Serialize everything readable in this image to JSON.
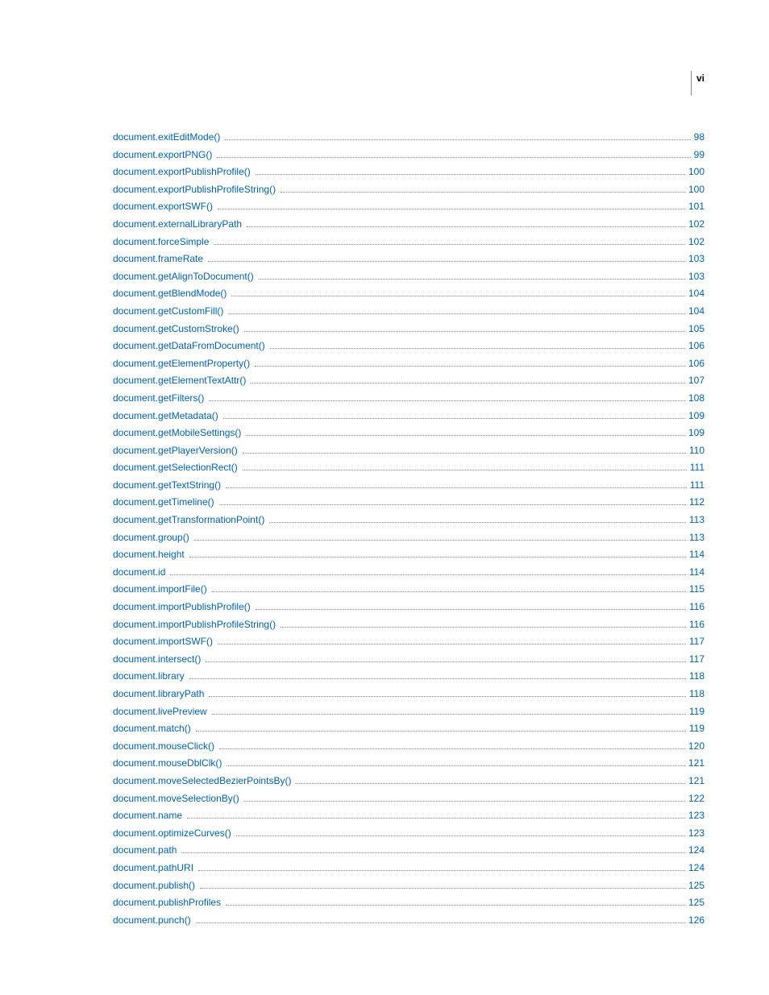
{
  "page_marker": "vi",
  "toc": [
    {
      "label": "document.exitEditMode()",
      "page": "98"
    },
    {
      "label": "document.exportPNG()",
      "page": "99"
    },
    {
      "label": "document.exportPublishProfile()",
      "page": "100"
    },
    {
      "label": "document.exportPublishProfileString()",
      "page": "100"
    },
    {
      "label": "document.exportSWF()",
      "page": "101"
    },
    {
      "label": "document.externalLibraryPath",
      "page": "102"
    },
    {
      "label": "document.forceSimple",
      "page": "102"
    },
    {
      "label": "document.frameRate",
      "page": "103"
    },
    {
      "label": "document.getAlignToDocument()",
      "page": "103"
    },
    {
      "label": "document.getBlendMode()",
      "page": "104"
    },
    {
      "label": "document.getCustomFill()",
      "page": "104"
    },
    {
      "label": "document.getCustomStroke()",
      "page": "105"
    },
    {
      "label": "document.getDataFromDocument()",
      "page": "106"
    },
    {
      "label": "document.getElementProperty()",
      "page": "106"
    },
    {
      "label": "document.getElementTextAttr()",
      "page": "107"
    },
    {
      "label": "document.getFilters()",
      "page": "108"
    },
    {
      "label": "document.getMetadata()",
      "page": "109"
    },
    {
      "label": "document.getMobileSettings()",
      "page": "109"
    },
    {
      "label": "document.getPlayerVersion()",
      "page": "110"
    },
    {
      "label": "document.getSelectionRect()",
      "page": "111"
    },
    {
      "label": "document.getTextString()",
      "page": "111"
    },
    {
      "label": "document.getTimeline()",
      "page": "112"
    },
    {
      "label": "document.getTransformationPoint()",
      "page": "113"
    },
    {
      "label": "document.group()",
      "page": "113"
    },
    {
      "label": "document.height",
      "page": "114"
    },
    {
      "label": "document.id",
      "page": "114"
    },
    {
      "label": "document.importFile()",
      "page": "115"
    },
    {
      "label": "document.importPublishProfile()",
      "page": "116"
    },
    {
      "label": "document.importPublishProfileString()",
      "page": "116"
    },
    {
      "label": "document.importSWF()",
      "page": "117"
    },
    {
      "label": "document.intersect()",
      "page": "117"
    },
    {
      "label": "document.library",
      "page": "118"
    },
    {
      "label": "document.libraryPath",
      "page": "118"
    },
    {
      "label": "document.livePreview",
      "page": "119"
    },
    {
      "label": "document.match()",
      "page": "119"
    },
    {
      "label": "document.mouseClick()",
      "page": "120"
    },
    {
      "label": "document.mouseDblClk()",
      "page": "121"
    },
    {
      "label": "document.moveSelectedBezierPointsBy()",
      "page": "121"
    },
    {
      "label": "document.moveSelectionBy()",
      "page": "122"
    },
    {
      "label": "document.name",
      "page": "123"
    },
    {
      "label": "document.optimizeCurves()",
      "page": "123"
    },
    {
      "label": "document.path",
      "page": "124"
    },
    {
      "label": "document.pathURI",
      "page": "124"
    },
    {
      "label": "document.publish()",
      "page": "125"
    },
    {
      "label": "document.publishProfiles",
      "page": "125"
    },
    {
      "label": "document.punch()",
      "page": "126"
    }
  ]
}
